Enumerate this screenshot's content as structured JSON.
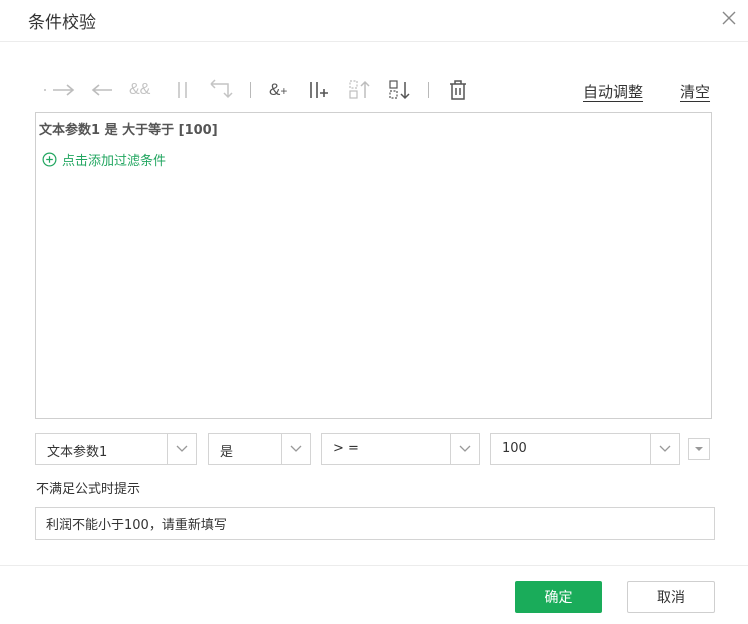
{
  "dialog": {
    "title": "条件校验",
    "close_icon": "close-icon"
  },
  "toolbar": {
    "icons": [
      "indent-right-icon",
      "indent-left-icon",
      "and-icon",
      "or-icon",
      "swap-icon",
      "add-and-icon",
      "add-or-icon",
      "move-up-icon",
      "move-down-icon",
      "delete-icon"
    ],
    "auto_adjust_label": "自动调整",
    "clear_label": "清空"
  },
  "conditions": {
    "items": [
      "文本参数1 是 大于等于 [100]"
    ],
    "add_filter_label": "点击添加过滤条件",
    "accent_color": "#22a660"
  },
  "editor": {
    "field_value": "文本参数1",
    "judge_value": "是",
    "operator_value": "> =",
    "compare_value": "100"
  },
  "hint": {
    "label": "不满足公式时提示",
    "value": "利润不能小于100，请重新填写"
  },
  "footer": {
    "ok_label": "确定",
    "cancel_label": "取消",
    "ok_color": "#1aac5a"
  }
}
